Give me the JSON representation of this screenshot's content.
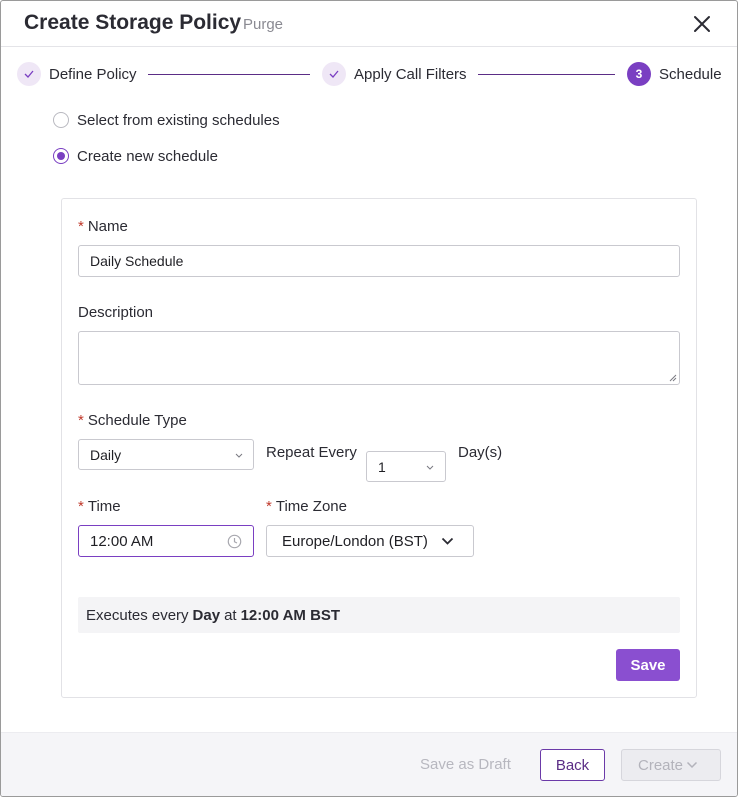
{
  "dialog": {
    "title": "Create Storage Policy",
    "subtitle": "Purge"
  },
  "icons": {
    "close": "close-icon",
    "check": "check-icon",
    "clock": "clock-icon",
    "chevron": "chevron-down-icon"
  },
  "colors": {
    "accent": "#7a3fc2",
    "accent_light": "#efe7f6",
    "required": "#c0392b",
    "save_button": "#8a4fd0"
  },
  "stepper": {
    "steps": [
      {
        "label": "Define Policy",
        "state": "completed"
      },
      {
        "label": "Apply Call Filters",
        "state": "completed"
      },
      {
        "number": "3",
        "label": "Schedule",
        "state": "active"
      }
    ]
  },
  "schedule_source": {
    "options": [
      {
        "label": "Select from existing schedules",
        "checked": false
      },
      {
        "label": "Create new schedule",
        "checked": true
      }
    ]
  },
  "form": {
    "name": {
      "label": "Name",
      "value": "Daily Schedule",
      "required": true
    },
    "description": {
      "label": "Description",
      "value": ""
    },
    "schedule_type": {
      "label": "Schedule Type",
      "value": "Daily",
      "required": true
    },
    "repeat_every": {
      "label": "Repeat Every",
      "value": "1",
      "unit": "Day(s)"
    },
    "time": {
      "label": "Time",
      "value": "12:00 AM",
      "required": true
    },
    "time_zone": {
      "label": "Time Zone",
      "value": "Europe/London (BST)",
      "required": true
    },
    "summary": {
      "prefix": "Executes every",
      "frequency": "Day",
      "connector": "at",
      "time": "12:00 AM BST"
    },
    "save_label": "Save"
  },
  "footer": {
    "save_draft_label": "Save as Draft",
    "back_label": "Back",
    "create_label": "Create"
  }
}
